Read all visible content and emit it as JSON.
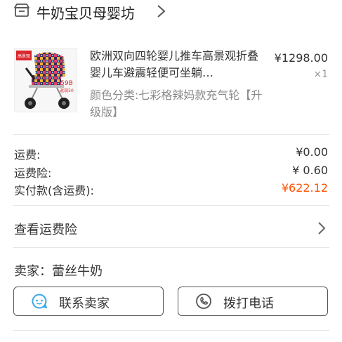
{
  "shop": {
    "name": "牛奶宝贝母婴坊"
  },
  "item": {
    "title": "欧洲双向四轮婴儿推车高景观折叠婴儿车避震轻便可坐躺…",
    "price": "¥1298.00",
    "quantity": "×1",
    "sku": "颜色分类:七彩格辣妈款充气轮【升级版】",
    "thumb_badge_top": "高景观",
    "thumb_price": "59B",
    "thumb_sub": "返现50"
  },
  "summary": [
    {
      "label": "运费:",
      "value": "¥0.00"
    },
    {
      "label": "运费险:",
      "value": "¥ 0.60"
    },
    {
      "label": "实付款(含运费):",
      "value": "¥622.12"
    }
  ],
  "insurance": {
    "label": "查看运费险"
  },
  "seller": {
    "label": "卖家：蕾丝牛奶"
  },
  "buttons": {
    "contact": "联系卖家",
    "call": "拨打电话"
  },
  "colors": {
    "accent": "#ff5000",
    "icon_blue": "#3aa8e8"
  }
}
